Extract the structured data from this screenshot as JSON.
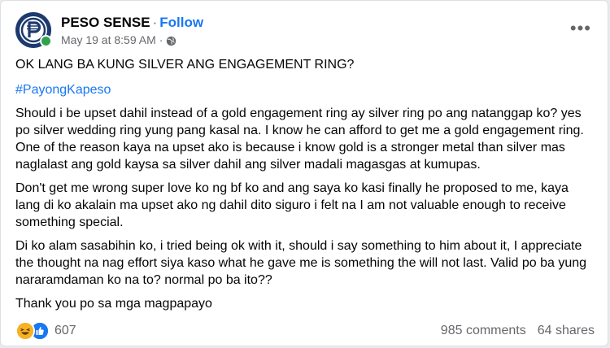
{
  "post": {
    "page_name": "PESO SENSE",
    "separator": "·",
    "follow_label": "Follow",
    "timestamp": "May 19 at 8:59 AM",
    "time_sep": "·",
    "privacy_icon": "globe-icon",
    "more_label": "•••",
    "title": "OK LANG BA KUNG SILVER ANG ENGAGEMENT RING?",
    "hashtag": "#PayongKapeso",
    "paragraphs": [
      "Should i be upset dahil instead of a gold engagement ring ay silver  ring po ang natanggap ko? yes po silver wedding ring yung pang kasal na. I know he can afford to get me a gold engagement ring. One of the reason kaya na upset ako is because i know gold is a stronger metal than silver mas naglalast ang gold kaysa sa silver dahil ang silver madali magasgas at kumupas.",
      "Don't get me wrong super love ko ng bf ko and ang saya ko kasi finally he proposed to me, kaya lang di ko akalain ma upset ako ng dahil dito siguro i felt na I am not valuable enough to receive something special.",
      "Di ko alam sasabihin ko, i tried being ok with it, should i say something to him about it, I appreciate the thought na nag effort siya kaso what he gave me is something the will not last. Valid po ba yung nararamdaman ko na to? normal po ba ito??",
      "Thank you po sa mga magpapayo"
    ]
  },
  "footer": {
    "reaction_icons": [
      "haha-reaction-icon",
      "like-reaction-icon"
    ],
    "reaction_count": "607",
    "comments": "985 comments",
    "shares": "64 shares"
  },
  "colors": {
    "link": "#1877f2",
    "secondary_text": "#65676b",
    "online": "#31a24c",
    "avatar_bg": "#1d3a6e"
  }
}
